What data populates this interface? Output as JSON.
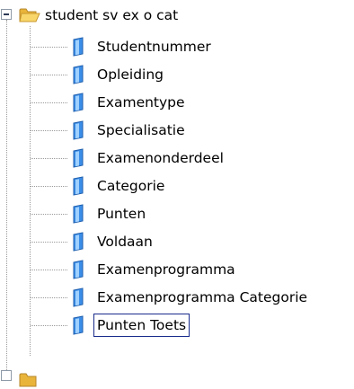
{
  "tree": {
    "root": {
      "label": "student sv ex o cat",
      "icon": "folder-open-icon",
      "expanded": true
    },
    "items": [
      {
        "label": "Studentnummer",
        "icon": "field-icon"
      },
      {
        "label": "Opleiding",
        "icon": "field-icon"
      },
      {
        "label": "Examentype",
        "icon": "field-icon"
      },
      {
        "label": "Specialisatie",
        "icon": "field-icon"
      },
      {
        "label": "Examenonderdeel",
        "icon": "field-icon"
      },
      {
        "label": "Categorie",
        "icon": "field-icon"
      },
      {
        "label": "Punten",
        "icon": "field-icon"
      },
      {
        "label": "Voldaan",
        "icon": "field-icon"
      },
      {
        "label": "Examenprogramma",
        "icon": "field-icon"
      },
      {
        "label": "Examenprogramma Categorie",
        "icon": "field-icon"
      },
      {
        "label": "Punten Toets",
        "icon": "field-icon",
        "selected": true
      }
    ],
    "colors": {
      "folder": "#f5c542",
      "field": "#3b8ee8",
      "selection_outline": "#1a2c8c",
      "tree_lines": "#9a9a9a"
    }
  }
}
